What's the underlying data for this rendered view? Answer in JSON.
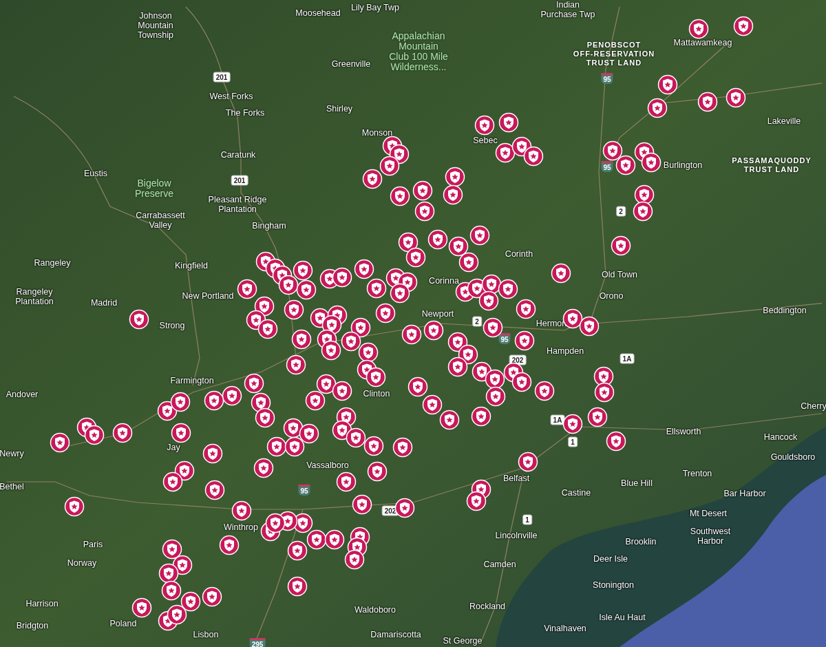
{
  "map": {
    "labels": [
      {
        "lines": [
          "Johnson",
          "Mountain",
          "Township"
        ],
        "kind": "place"
      },
      {
        "lines": [
          "Moosehead"
        ],
        "kind": "place"
      },
      {
        "lines": [
          "Lily Bay Twp"
        ],
        "kind": "place"
      },
      {
        "lines": [
          "Indian",
          "Purchase Twp"
        ],
        "kind": "place"
      },
      {
        "lines": [
          "Greenville"
        ],
        "kind": "place"
      },
      {
        "lines": [
          "Appalachian",
          "Mountain",
          "Club 100 Mile",
          "Wilderness..."
        ],
        "kind": "park"
      },
      {
        "lines": [
          "PENOBSCOT",
          "OFF-RESERVATION",
          "TRUST LAND"
        ],
        "kind": "reservation"
      },
      {
        "lines": [
          "Mattawamkeag"
        ],
        "kind": "place"
      },
      {
        "lines": [
          "West Forks"
        ],
        "kind": "place"
      },
      {
        "lines": [
          "The Forks"
        ],
        "kind": "place"
      },
      {
        "lines": [
          "Shirley"
        ],
        "kind": "place"
      },
      {
        "lines": [
          "Monson"
        ],
        "kind": "place"
      },
      {
        "lines": [
          "Sebec"
        ],
        "kind": "place"
      },
      {
        "lines": [
          "Caratunk"
        ],
        "kind": "place"
      },
      {
        "lines": [
          "Eustis"
        ],
        "kind": "place"
      },
      {
        "lines": [
          "Bigelow",
          "Preserve"
        ],
        "kind": "park"
      },
      {
        "lines": [
          "Carrabassett",
          "Valley"
        ],
        "kind": "place"
      },
      {
        "lines": [
          "Pleasant Ridge",
          "Plantation"
        ],
        "kind": "place"
      },
      {
        "lines": [
          "Bingham"
        ],
        "kind": "place"
      },
      {
        "lines": [
          "Burlington"
        ],
        "kind": "place"
      },
      {
        "lines": [
          "Lakeville"
        ],
        "kind": "place"
      },
      {
        "lines": [
          "PASSAMAQUODDY",
          "TRUST LAND"
        ],
        "kind": "reservation"
      },
      {
        "lines": [
          "Corinth"
        ],
        "kind": "place"
      },
      {
        "lines": [
          "Old Town"
        ],
        "kind": "place"
      },
      {
        "lines": [
          "Orono"
        ],
        "kind": "place"
      },
      {
        "lines": [
          "Beddington"
        ],
        "kind": "place"
      },
      {
        "lines": [
          "Rangeley"
        ],
        "kind": "place"
      },
      {
        "lines": [
          "Rangeley",
          "Plantation"
        ],
        "kind": "place"
      },
      {
        "lines": [
          "Kingfield"
        ],
        "kind": "place"
      },
      {
        "lines": [
          "New Portland"
        ],
        "kind": "place"
      },
      {
        "lines": [
          "Madrid"
        ],
        "kind": "place"
      },
      {
        "lines": [
          "Strong"
        ],
        "kind": "place"
      },
      {
        "lines": [
          "Corinna"
        ],
        "kind": "place"
      },
      {
        "lines": [
          "Newport"
        ],
        "kind": "place"
      },
      {
        "lines": [
          "Hermon"
        ],
        "kind": "place"
      },
      {
        "lines": [
          "Hampden"
        ],
        "kind": "place"
      },
      {
        "lines": [
          "Farmington"
        ],
        "kind": "place"
      },
      {
        "lines": [
          "Andover"
        ],
        "kind": "place"
      },
      {
        "lines": [
          "Clinton"
        ],
        "kind": "place"
      },
      {
        "lines": [
          "Jay"
        ],
        "kind": "place"
      },
      {
        "lines": [
          "Newry"
        ],
        "kind": "place"
      },
      {
        "lines": [
          "Bethel"
        ],
        "kind": "place"
      },
      {
        "lines": [
          "Vassalboro"
        ],
        "kind": "place"
      },
      {
        "lines": [
          "Ellsworth"
        ],
        "kind": "place"
      },
      {
        "lines": [
          "Hancock"
        ],
        "kind": "place"
      },
      {
        "lines": [
          "Gouldsboro"
        ],
        "kind": "place"
      },
      {
        "lines": [
          "Cherry"
        ],
        "kind": "place"
      },
      {
        "lines": [
          "Belfast"
        ],
        "kind": "place"
      },
      {
        "lines": [
          "Castine"
        ],
        "kind": "place"
      },
      {
        "lines": [
          "Blue Hill"
        ],
        "kind": "place"
      },
      {
        "lines": [
          "Trenton"
        ],
        "kind": "place"
      },
      {
        "lines": [
          "Bar Harbor"
        ],
        "kind": "place"
      },
      {
        "lines": [
          "Mt Desert"
        ],
        "kind": "place"
      },
      {
        "lines": [
          "Lincolnville"
        ],
        "kind": "place"
      },
      {
        "lines": [
          "Brooklin"
        ],
        "kind": "place"
      },
      {
        "lines": [
          "Southwest",
          "Harbor"
        ],
        "kind": "place"
      },
      {
        "lines": [
          "Deer Isle"
        ],
        "kind": "place"
      },
      {
        "lines": [
          "Camden"
        ],
        "kind": "place"
      },
      {
        "lines": [
          "Stonington"
        ],
        "kind": "place"
      },
      {
        "lines": [
          "Rockland"
        ],
        "kind": "place"
      },
      {
        "lines": [
          "Isle Au Haut"
        ],
        "kind": "place"
      },
      {
        "lines": [
          "Vinalhaven"
        ],
        "kind": "place"
      },
      {
        "lines": [
          "St George"
        ],
        "kind": "place"
      },
      {
        "lines": [
          "Winthrop"
        ],
        "kind": "place"
      },
      {
        "lines": [
          "Paris"
        ],
        "kind": "place"
      },
      {
        "lines": [
          "Norway"
        ],
        "kind": "place"
      },
      {
        "lines": [
          "Harrison"
        ],
        "kind": "place"
      },
      {
        "lines": [
          "Bridgton"
        ],
        "kind": "place"
      },
      {
        "lines": [
          "Poland"
        ],
        "kind": "place"
      },
      {
        "lines": [
          "Lisbon"
        ],
        "kind": "place"
      },
      {
        "lines": [
          "Waldoboro"
        ],
        "kind": "place"
      },
      {
        "lines": [
          "Damariscotta"
        ],
        "kind": "place"
      }
    ],
    "shields": [
      {
        "text": "201",
        "kind": "us"
      },
      {
        "text": "201",
        "kind": "us"
      },
      {
        "text": "95",
        "kind": "interstate"
      },
      {
        "text": "95",
        "kind": "interstate"
      },
      {
        "text": "2",
        "kind": "us"
      },
      {
        "text": "2",
        "kind": "us"
      },
      {
        "text": "95",
        "kind": "interstate"
      },
      {
        "text": "202",
        "kind": "us"
      },
      {
        "text": "1A",
        "kind": "us"
      },
      {
        "text": "1A",
        "kind": "us"
      },
      {
        "text": "1",
        "kind": "us"
      },
      {
        "text": "1",
        "kind": "us"
      },
      {
        "text": "295",
        "kind": "interstate"
      },
      {
        "text": "95",
        "kind": "interstate"
      },
      {
        "text": "202",
        "kind": "us"
      }
    ]
  }
}
